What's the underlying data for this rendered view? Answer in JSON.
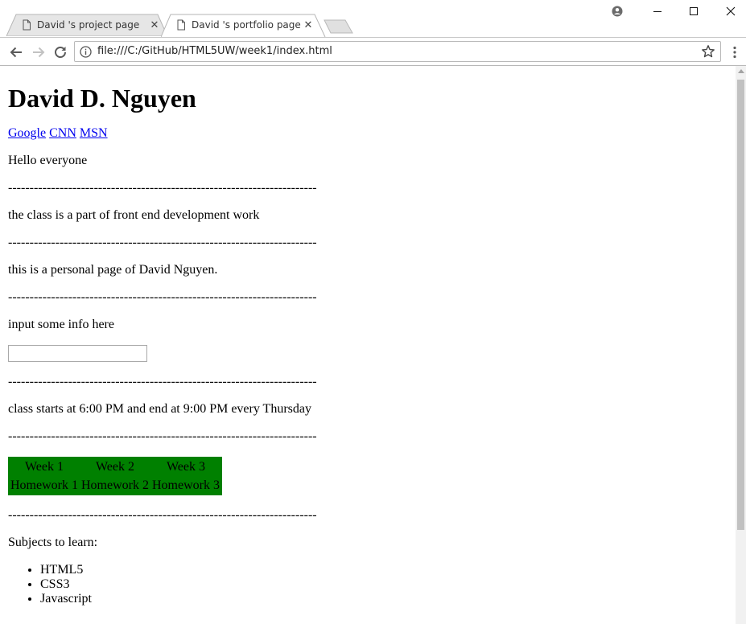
{
  "browser": {
    "tabs": [
      {
        "title": "David 's project page",
        "active": false
      },
      {
        "title": "David 's portfolio page",
        "active": true
      }
    ],
    "url": "file:///C:/GitHub/HTML5UW/week1/index.html"
  },
  "page": {
    "heading": "David D. Nguyen",
    "links": [
      "Google",
      "CNN",
      "MSN"
    ],
    "greeting": "Hello everyone",
    "separator": "------------------------------------------------------------------------",
    "class_info": "the class is a part of front end development work",
    "personal_info": "this is a personal page of David Nguyen.",
    "input_prompt": "input some info here",
    "input_value": "",
    "schedule": "class starts at 6:00 PM and end at 9:00 PM every Thursday",
    "table": {
      "headers": [
        "Week 1",
        "Week 2",
        "Week 3"
      ],
      "cells": [
        "Homework 1",
        "Homework 2",
        "Homework 3"
      ],
      "background": "#008000"
    },
    "subjects_title": "Subjects to learn:",
    "subjects": [
      "HTML5",
      "CSS3",
      "Javascript"
    ]
  }
}
